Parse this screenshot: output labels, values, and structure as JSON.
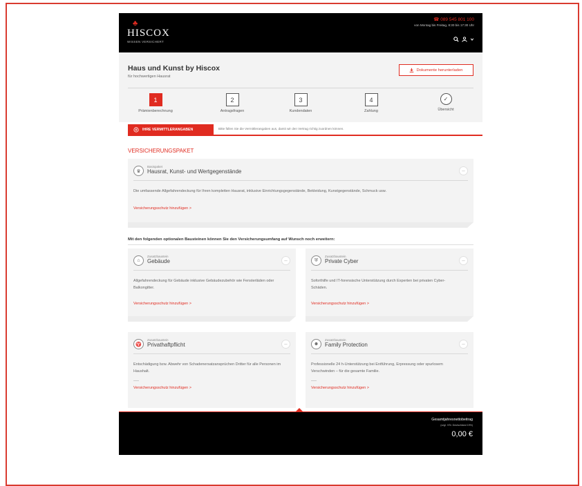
{
  "header": {
    "logo_mark": "♣",
    "logo_name": "HISCOX",
    "logo_tagline": "WISSEN VERSICHERT",
    "phone": "☎ 089 545 801 100",
    "hours": "von Montag bis Freitag, 8:30 bis 17:30 Uhr",
    "search_icon": "search-icon",
    "user_icon": "user-icon"
  },
  "product": {
    "title": "Haus und Kunst by Hiscox",
    "subtitle": "für hochwertigen Hausrat",
    "download_label": "Dokumente herunterladen"
  },
  "steps": [
    {
      "number": "1",
      "label": "Prämienberechnung",
      "active": true
    },
    {
      "number": "2",
      "label": "Antragsfragen"
    },
    {
      "number": "3",
      "label": "Kundendaten"
    },
    {
      "number": "4",
      "label": "Zahlung"
    },
    {
      "number": "✓",
      "label": "Übersicht"
    }
  ],
  "vermittler": {
    "button_label": "IHRE VERMITTLERANGABEN",
    "hint": "Bitte füllen Sie die Vermittlerangaben aus, damit wir den Vertrag richtig zuordnen können."
  },
  "section_title": "VERSICHERUNGSPAKET",
  "base_package": {
    "type": "Basispaket",
    "name": "Hausrat, Kunst- und Wertgegenstände",
    "description": "Die umfassende Allgefahrendeckung für Ihren kompletten Hausrat, inklusive Einrichtungsgegenstände, Bekleidung, Kunstgegenstände, Schmuck usw.",
    "link": "Versicherungsschutz hinzufügen >"
  },
  "optional_intro": "Mit den folgenden optionalen Bausteinen können Sie den Versicherungsumfang auf Wunsch noch erweitern:",
  "addons": [
    {
      "type": "Zusatzbaustein",
      "name": "Gebäude",
      "description": "Allgefahrendeckung für Gebäude inklusive Gebäudezubehör wie Fensterläden oder Balkongitter.",
      "link": "Versicherungsschutz hinzufügen >"
    },
    {
      "type": "Zusatzbaustein",
      "name": "Private Cyber",
      "description": "Soforthilfe und IT-forensische Unterstützung durch Experten bei privaten Cyber-Schäden.",
      "link": "Versicherungsschutz hinzufügen >"
    },
    {
      "type": "Zusatzbaustein",
      "name": "Privathaftpflicht",
      "description": "Entschädigung bzw. Abwehr von Schadenersatzansprüchen Dritter für alle Personen im Haushalt.",
      "link": "Versicherungsschutz hinzufügen >"
    },
    {
      "type": "Zusatzbaustein",
      "name": "Family Protection",
      "description": "Professionelle 24 h-Unterstützung bei Entführung, Erpressung oder spurlosem Verschwinden – für die gesamte Familie.",
      "link": "Versicherungsschutz hinzufügen >"
    }
  ],
  "icons": {
    "base": "crown-icon",
    "gebaeude": "house-icon",
    "cyber": "shield-lock-icon",
    "haftpflicht": "trophy-icon",
    "family": "family-icon"
  },
  "toggle_symbol": "–",
  "footer": {
    "total_label": "Gesamtjahresnettobeitrag",
    "total_note": "(zzgl. VSt. Deutschland 19%)",
    "total_value": "0,00 €"
  },
  "colors": {
    "accent": "#e02b20",
    "dark": "#000000",
    "panel": "#f3f3f3"
  }
}
